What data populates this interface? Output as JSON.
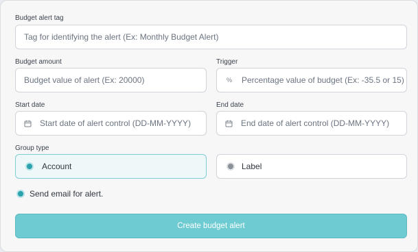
{
  "form": {
    "tag": {
      "label": "Budget alert tag",
      "placeholder": "Tag for identifying the alert (Ex: Monthly Budget Alert)"
    },
    "amount": {
      "label": "Budget amount",
      "placeholder": "Budget value of alert (Ex: 20000)"
    },
    "trigger": {
      "label": "Trigger",
      "icon_glyph": "%",
      "placeholder": "Percentage value of budget (Ex: -35.5 or 15)"
    },
    "start": {
      "label": "Start date",
      "placeholder": "Start date of alert control (DD-MM-YYYY)"
    },
    "end": {
      "label": "End date",
      "placeholder": "End date of alert control (DD-MM-YYYY)"
    },
    "group": {
      "label": "Group type",
      "options": [
        {
          "label": "Account",
          "selected": true
        },
        {
          "label": "Label",
          "selected": false
        }
      ]
    },
    "email": {
      "label": "Send email for alert.",
      "checked": true
    },
    "submit_label": "Create budget alert"
  },
  "colors": {
    "accent": "#2aa3ad",
    "button": "#6ecbd2",
    "selected_bg": "#eef8f9",
    "unselected_dot": "#8a9098"
  }
}
